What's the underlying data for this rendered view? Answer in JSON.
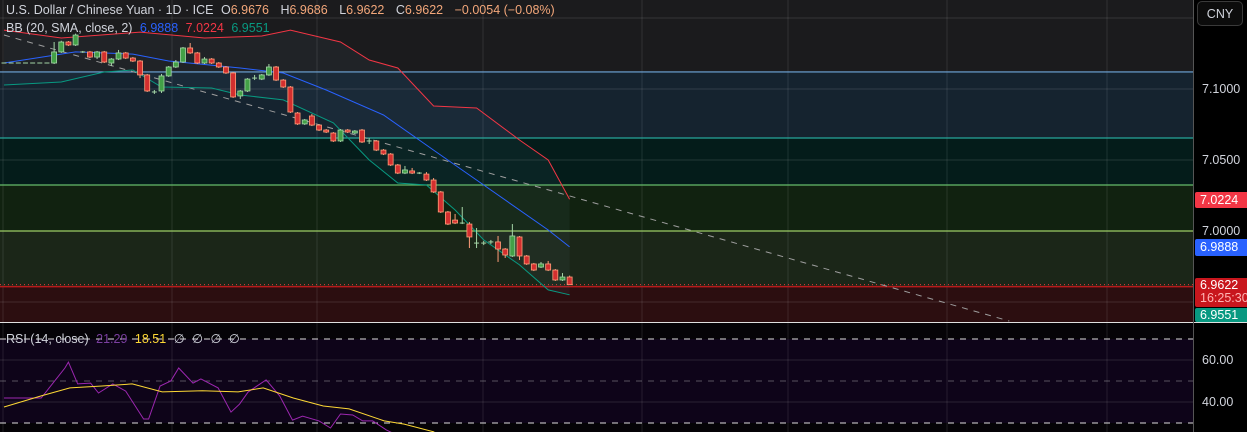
{
  "header": {
    "symbol_title": "U.S. Dollar / Chinese Yuan · 1D · ICE",
    "open_label": "O",
    "open": "6.9676",
    "high_label": "H",
    "high": "6.9686",
    "low_label": "L",
    "low": "6.9622",
    "close_label": "C",
    "close": "6.9622",
    "change": "−0.0054 (−0.08%)"
  },
  "bb_legend": {
    "label": "BB (20, SMA, close, 2)",
    "basis": "6.9888",
    "upper": "7.0224",
    "lower": "6.9551"
  },
  "rsi_legend": {
    "label": "RSI (14, close)",
    "rsi": "21.29",
    "ma": "18.51",
    "na": [
      "∅",
      "∅",
      "∅",
      "∅"
    ]
  },
  "axis": {
    "currency": "CNY",
    "price_ticks": [
      "7.1000",
      "7.0500",
      "7.0000"
    ],
    "upper_tag": "7.0224",
    "basis_tag": "6.9888",
    "last_tag": "6.9622",
    "countdown": "16:25:30",
    "lower_tag": "6.9551",
    "rsi_ticks": [
      "60.00",
      "40.00"
    ]
  },
  "colors": {
    "up": "#43a047",
    "up_border": "#a5d6a7",
    "down": "#d32f2f",
    "down_border": "#ff9e7a",
    "bb_upper": "#f23645",
    "bb_basis": "#2962ff",
    "bb_lower": "#089981",
    "rsi": "#9c27b0",
    "rsi_ma": "#fdd835"
  },
  "chart_data": {
    "type": "candlestick",
    "title": "U.S. Dollar / Chinese Yuan · 1D · ICE",
    "ylim": [
      6.9359,
      7.1627
    ],
    "grid": true,
    "levels": [
      7.112,
      7.0655,
      7.0324,
      7.0
    ],
    "trendline": [
      [
        0,
        7.138
      ],
      [
        140.4,
        6.9366
      ]
    ],
    "candles": [
      [
        7.1183,
        7.1186,
        7.118,
        7.1183
      ],
      [
        7.1183,
        7.1186,
        7.118,
        7.1183
      ],
      [
        7.1183,
        7.1186,
        7.118,
        7.1183
      ],
      [
        7.1183,
        7.1186,
        7.118,
        7.1183
      ],
      [
        7.1183,
        7.1186,
        7.118,
        7.1183
      ],
      [
        7.1183,
        7.1186,
        7.118,
        7.1183
      ],
      [
        7.1183,
        7.1186,
        7.118,
        7.1183
      ],
      [
        7.1183,
        7.1331,
        7.1176,
        7.1261
      ],
      [
        7.1261,
        7.134,
        7.1254,
        7.1331
      ],
      [
        7.1331,
        7.1338,
        7.1303,
        7.131
      ],
      [
        7.131,
        7.139,
        7.1303,
        7.138
      ],
      [
        7.1261,
        7.1268,
        7.1254,
        7.1261
      ],
      [
        7.1261,
        7.1268,
        7.1218,
        7.1225
      ],
      [
        7.1225,
        7.1268,
        7.1211,
        7.1261
      ],
      [
        7.1261,
        7.1268,
        7.1183,
        7.119
      ],
      [
        7.1183,
        7.1218,
        7.1162,
        7.1211
      ],
      [
        7.1211,
        7.1275,
        7.1204,
        7.1254
      ],
      [
        7.1254,
        7.1261,
        7.1211,
        7.1218
      ],
      [
        7.1218,
        7.1225,
        7.119,
        7.1197
      ],
      [
        7.1197,
        7.1204,
        7.1077,
        7.1099
      ],
      [
        7.1099,
        7.1106,
        7.0979,
        7.0986
      ],
      [
        7.0979,
        7.0993,
        7.0965,
        7.0979
      ],
      [
        7.0986,
        7.1106,
        7.0972,
        7.1092
      ],
      [
        7.1092,
        7.1162,
        7.1085,
        7.1155
      ],
      [
        7.1155,
        7.1204,
        7.1148,
        7.119
      ],
      [
        7.119,
        7.1296,
        7.1183,
        7.1289
      ],
      [
        7.1289,
        7.1324,
        7.1247,
        7.1254
      ],
      [
        7.1254,
        7.1261,
        7.1176,
        7.1183
      ],
      [
        7.1183,
        7.1225,
        7.1176,
        7.1211
      ],
      [
        7.1211,
        7.1218,
        7.1176,
        7.1183
      ],
      [
        7.1183,
        7.119,
        7.1148,
        7.1155
      ],
      [
        7.1155,
        7.1162,
        7.1106,
        7.1113
      ],
      [
        7.1113,
        7.112,
        7.0937,
        7.0944
      ],
      [
        7.0951,
        7.0993,
        7.093,
        7.0986
      ],
      [
        7.0986,
        7.1077,
        7.0979,
        7.107
      ],
      [
        7.1077,
        7.1099,
        7.1063,
        7.1077
      ],
      [
        7.107,
        7.1106,
        7.1063,
        7.1099
      ],
      [
        7.1099,
        7.1176,
        7.1092,
        7.1155
      ],
      [
        7.1155,
        7.1162,
        7.1056,
        7.1063
      ],
      [
        7.1063,
        7.107,
        7.1007,
        7.1014
      ],
      [
        7.1014,
        7.1021,
        7.0831,
        7.0838
      ],
      [
        7.0831,
        7.0838,
        7.0747,
        7.0754
      ],
      [
        7.0754,
        7.0789,
        7.0747,
        7.0782
      ],
      [
        7.081,
        7.0824,
        7.0739,
        7.0746
      ],
      [
        7.0746,
        7.0753,
        7.0704,
        7.0711
      ],
      [
        7.0711,
        7.0718,
        7.069,
        7.0697
      ],
      [
        7.069,
        7.0697,
        7.0627,
        7.0634
      ],
      [
        7.0634,
        7.0718,
        7.0627,
        7.0711
      ],
      [
        7.0711,
        7.0718,
        7.069,
        7.0697
      ],
      [
        7.069,
        7.0711,
        7.0683,
        7.0704
      ],
      [
        7.0711,
        7.0718,
        7.062,
        7.0627
      ],
      [
        7.0634,
        7.0655,
        7.0613,
        7.0634
      ],
      [
        7.0634,
        7.0641,
        7.0563,
        7.057
      ],
      [
        7.057,
        7.0577,
        7.0535,
        7.0542
      ],
      [
        7.0542,
        7.0549,
        7.0458,
        7.0465
      ],
      [
        7.0465,
        7.0472,
        7.0401,
        7.0408
      ],
      [
        7.0408,
        7.0458,
        7.0401,
        7.043
      ],
      [
        7.0423,
        7.0444,
        7.0401,
        7.0408
      ],
      [
        7.0408,
        7.0415,
        7.0401,
        7.0408
      ],
      [
        7.0401,
        7.0415,
        7.0352,
        7.0359
      ],
      [
        7.0359,
        7.0373,
        7.0268,
        7.0275
      ],
      [
        7.0275,
        7.0282,
        7.0127,
        7.0134
      ],
      [
        7.0134,
        7.0141,
        7.0042,
        7.0049
      ],
      [
        7.0077,
        7.012,
        7.0049,
        7.0056
      ],
      [
        7.0056,
        7.0169,
        7.0049,
        7.0056
      ],
      [
        7.0049,
        7.0063,
        6.988,
        6.9958
      ],
      [
        6.9915,
        7.0021,
        6.988,
        6.9915
      ],
      [
        6.9915,
        6.993,
        6.9901,
        6.9915
      ],
      [
        6.9923,
        6.9937,
        6.9908,
        6.9923
      ],
      [
        6.9923,
        6.9965,
        6.9782,
        6.9873
      ],
      [
        6.9873,
        6.988,
        6.981,
        6.9831
      ],
      [
        6.9824,
        7.0049,
        6.9817,
        6.9965
      ],
      [
        6.9958,
        6.9965,
        6.9796,
        6.9824
      ],
      [
        6.9824,
        6.9831,
        6.9761,
        6.9768
      ],
      [
        6.9768,
        6.9775,
        6.9718,
        6.9725
      ],
      [
        6.9746,
        6.9782,
        6.9739,
        6.9768
      ],
      [
        6.9768,
        6.9789,
        6.9718,
        6.9725
      ],
      [
        6.9725,
        6.9732,
        6.9648,
        6.9655
      ],
      [
        6.9655,
        6.9704,
        6.9648,
        6.9676
      ],
      [
        6.9676,
        6.9686,
        6.9622,
        6.9622
      ]
    ],
    "bollinger": {
      "upper": [
        [
          0,
          7.1415
        ],
        [
          8,
          7.1359
        ],
        [
          19,
          7.1401
        ],
        [
          28,
          7.1359
        ],
        [
          36,
          7.1373
        ],
        [
          40,
          7.1415
        ],
        [
          47,
          7.1331
        ],
        [
          51,
          7.1204
        ],
        [
          55,
          7.1148
        ],
        [
          60,
          7.088
        ],
        [
          66,
          7.0866
        ],
        [
          72,
          7.0641
        ],
        [
          76,
          7.05
        ],
        [
          79,
          7.0224
        ]
      ],
      "middle": [
        [
          0,
          7.1183
        ],
        [
          10,
          7.1261
        ],
        [
          18,
          7.1246
        ],
        [
          23,
          7.1197
        ],
        [
          33,
          7.1148
        ],
        [
          39,
          7.1113
        ],
        [
          45,
          7.0993
        ],
        [
          53,
          7.0817
        ],
        [
          60,
          7.057
        ],
        [
          67,
          7.0324
        ],
        [
          76,
          7.0007
        ],
        [
          79,
          6.9888
        ]
      ],
      "lower": [
        [
          0,
          7.1028
        ],
        [
          8,
          7.1049
        ],
        [
          14,
          7.112
        ],
        [
          18,
          7.1134
        ],
        [
          22,
          7.1014
        ],
        [
          29,
          7.1007
        ],
        [
          33,
          7.0958
        ],
        [
          39,
          7.0923
        ],
        [
          46,
          7.0761
        ],
        [
          51,
          7.05
        ],
        [
          55,
          7.0338
        ],
        [
          59,
          7.0324
        ],
        [
          63,
          7.0148
        ],
        [
          67,
          6.9937
        ],
        [
          72,
          6.9761
        ],
        [
          76,
          6.9585
        ],
        [
          79,
          6.9551
        ]
      ]
    },
    "rsi": {
      "ylim": [
        25.7,
        78.1
      ],
      "levels": [
        70,
        50,
        30
      ],
      "values": [
        [
          0,
          41.9
        ],
        [
          5.2,
          41.9
        ],
        [
          8.5,
          56.2
        ],
        [
          9,
          59.0
        ],
        [
          10.3,
          48.6
        ],
        [
          12.1,
          49.0
        ],
        [
          13.2,
          44.3
        ],
        [
          15.2,
          48.6
        ],
        [
          17,
          45.2
        ],
        [
          19.5,
          31.9
        ],
        [
          20.2,
          31.9
        ],
        [
          21.8,
          47.6
        ],
        [
          23.3,
          50.0
        ],
        [
          24.4,
          56.2
        ],
        [
          26.4,
          49.0
        ],
        [
          27.5,
          51.0
        ],
        [
          29.9,
          46.7
        ],
        [
          31.7,
          35.2
        ],
        [
          32.9,
          39.0
        ],
        [
          34.1,
          44.8
        ],
        [
          36.6,
          50.5
        ],
        [
          38.5,
          42.9
        ],
        [
          40.3,
          31.4
        ],
        [
          41.7,
          33.3
        ],
        [
          44,
          31.0
        ],
        [
          45.6,
          27.6
        ],
        [
          47,
          34.3
        ],
        [
          48.7,
          33.8
        ],
        [
          50.1,
          31.0
        ],
        [
          51.5,
          31.0
        ],
        [
          53.4,
          26.7
        ],
        [
          55,
          24.0
        ]
      ],
      "ma": [
        [
          0,
          37.6
        ],
        [
          5.2,
          42.9
        ],
        [
          9.2,
          46.7
        ],
        [
          13.7,
          47.6
        ],
        [
          17.9,
          48.6
        ],
        [
          22.1,
          44.8
        ],
        [
          27.7,
          45.4
        ],
        [
          32.7,
          44.8
        ],
        [
          36.2,
          46.7
        ],
        [
          40.4,
          41.9
        ],
        [
          44.6,
          38.1
        ],
        [
          48.2,
          36.7
        ],
        [
          53.1,
          31.0
        ],
        [
          55.9,
          29.5
        ],
        [
          60.1,
          25.7
        ]
      ]
    }
  }
}
